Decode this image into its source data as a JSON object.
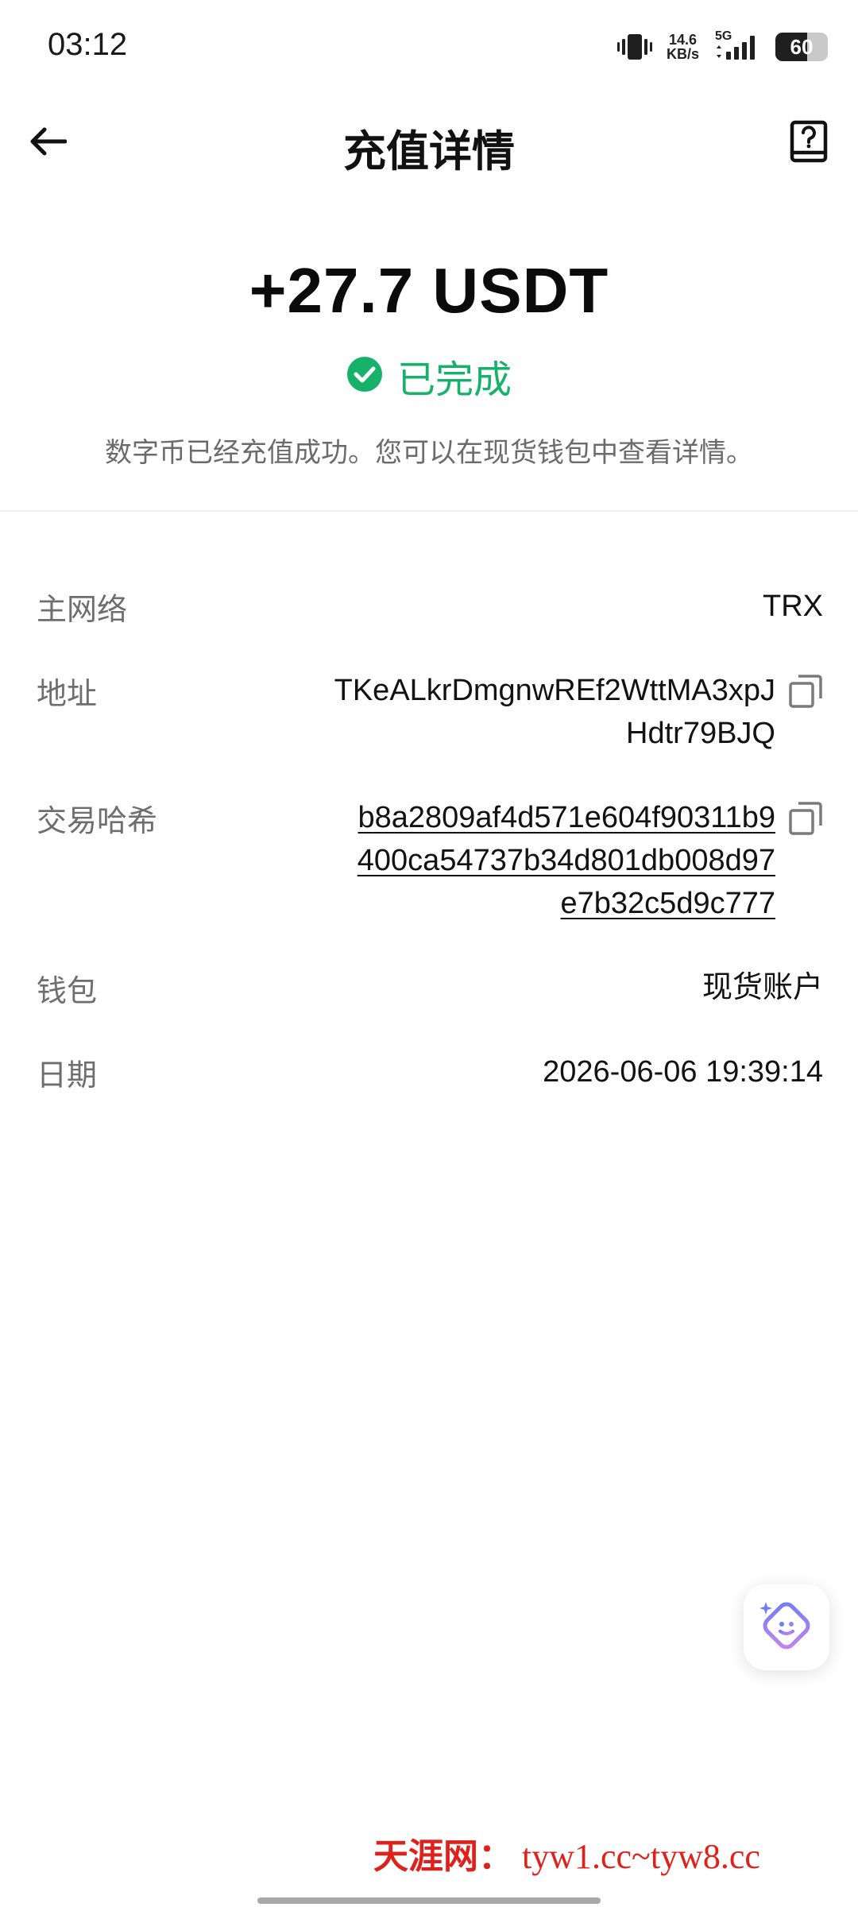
{
  "status_bar": {
    "time": "03:12",
    "net_speed_value": "14.6",
    "net_speed_unit": "KB/s",
    "network_type": "5G",
    "battery_level": "60"
  },
  "nav": {
    "title": "充值详情",
    "back_icon": "arrow-left-icon",
    "help_icon": "help-book-icon"
  },
  "summary": {
    "amount": "+27.7 USDT",
    "status": "已完成",
    "status_color": "#17b26a",
    "description": "数字币已经充值成功。您可以在现货钱包中查看详情。"
  },
  "details": {
    "network_label": "主网络",
    "network_value": "TRX",
    "address_label": "地址",
    "address_line1": "TKeALkrDmgnwREf2WttMA3xpJ",
    "address_line2": "Hdtr79BJQ",
    "hash_label": "交易哈希",
    "hash_line1": "b8a2809af4d571e604f90311b9",
    "hash_line2": "400ca54737b34d801db008d97",
    "hash_line3": "e7b32c5d9c777",
    "wallet_label": "钱包",
    "wallet_value": "现货账户",
    "date_label": "日期",
    "date_value": "2026-06-06 19:39:14"
  },
  "watermark": {
    "site_name": "天涯网：",
    "domains": "tyw1.cc~tyw8.cc"
  }
}
